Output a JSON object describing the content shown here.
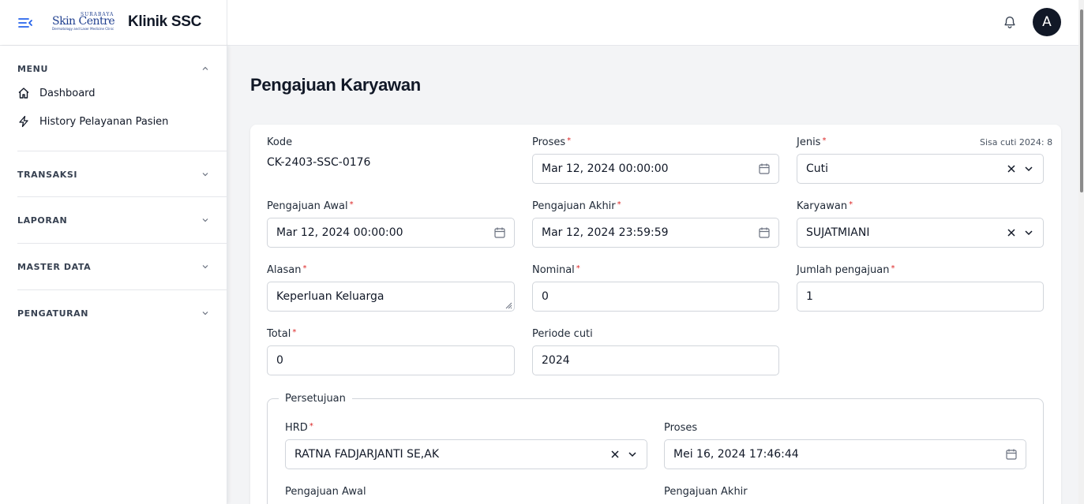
{
  "header": {
    "logo": {
      "top": "SURABAYA",
      "main": "Skin Centre",
      "sub": "Dermatology and Laser Medicine Clinic"
    },
    "app_title": "Klinik SSC",
    "avatar_initial": "A"
  },
  "sidebar": {
    "menu_label": "MENU",
    "items": [
      {
        "label": "Dashboard",
        "icon": "home-icon"
      },
      {
        "label": "History Pelayanan Pasien",
        "icon": "lightning-icon"
      }
    ],
    "sections": [
      "TRANSAKSI",
      "LAPORAN",
      "MASTER DATA",
      "PENGATURAN"
    ]
  },
  "page": {
    "title": "Pengajuan Karyawan"
  },
  "form": {
    "kode": {
      "label": "Kode",
      "value": "CK-2403-SSC-0176"
    },
    "proses": {
      "label": "Proses",
      "value": "Mar 12, 2024 00:00:00"
    },
    "jenis": {
      "label": "Jenis",
      "value": "Cuti",
      "hint": "Sisa cuti 2024: 8"
    },
    "pengajuan_awal": {
      "label": "Pengajuan Awal",
      "value": "Mar 12, 2024 00:00:00"
    },
    "pengajuan_akhir": {
      "label": "Pengajuan Akhir",
      "value": "Mar 12, 2024 23:59:59"
    },
    "karyawan": {
      "label": "Karyawan",
      "value": "SUJATMIANI"
    },
    "alasan": {
      "label": "Alasan",
      "value": "Keperluan Keluarga"
    },
    "nominal": {
      "label": "Nominal",
      "value": "0"
    },
    "jumlah_pengajuan": {
      "label": "Jumlah pengajuan",
      "value": "1"
    },
    "total": {
      "label": "Total",
      "value": "0"
    },
    "periode_cuti": {
      "label": "Periode cuti",
      "value": "2024"
    }
  },
  "persetujuan": {
    "legend": "Persetujuan",
    "hrd": {
      "label": "HRD",
      "value": "RATNA FADJARJANTI SE,AK"
    },
    "proses": {
      "label": "Proses",
      "value": "Mei 16, 2024 17:46:44"
    },
    "pengajuan_awal_label": "Pengajuan Awal",
    "pengajuan_akhir_label": "Pengajuan Akhir"
  },
  "colors": {
    "required": "#dc2626",
    "accent": "#1d4ed8",
    "avatar_bg": "#111827"
  }
}
